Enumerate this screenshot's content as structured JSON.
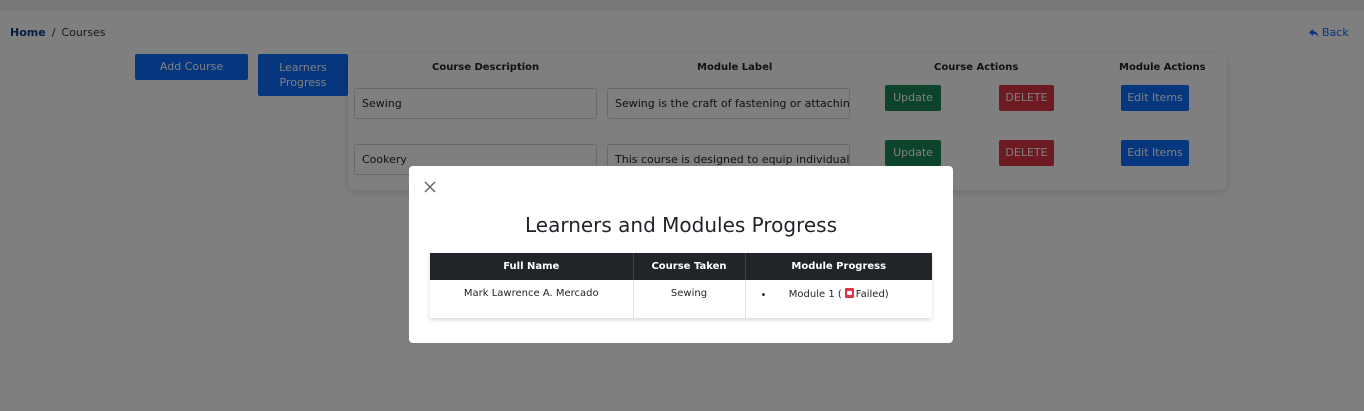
{
  "breadcrumb": {
    "home": "Home",
    "separator": "/",
    "current": "Courses"
  },
  "back": {
    "label": "Back",
    "icon": "reply-arrow-icon"
  },
  "toolbar": {
    "add_course": "Add Course",
    "learners_progress": "Learners Progress"
  },
  "courses_table": {
    "headers": {
      "description": "Course Description",
      "module_label": "Module Label",
      "course_actions": "Course Actions",
      "module_actions": "Module Actions"
    },
    "rows": [
      {
        "description": "Sewing",
        "module_label": "Sewing is the craft of fastening or attaching",
        "update": "Update",
        "delete": "DELETE",
        "edit_items": "Edit Items"
      },
      {
        "description": "Cookery",
        "module_label": "This course is designed to equip individuals",
        "update": "Update",
        "delete": "DELETE",
        "edit_items": "Edit Items"
      }
    ]
  },
  "modal": {
    "title": "Learners and Modules Progress",
    "close_icon": "close-icon",
    "table": {
      "headers": {
        "full_name": "Full Name",
        "course_taken": "Course Taken",
        "module_progress": "Module Progress"
      },
      "rows": [
        {
          "full_name": "Mark Lawrence A. Mercado",
          "course_taken": "Sewing",
          "bullet": "•",
          "module": "Module 1",
          "status_prefix": "(",
          "status": "Failed)",
          "status_icon": "pdf-file-icon"
        }
      ]
    }
  },
  "colors": {
    "primary": "#0d6efd",
    "success": "#198754",
    "danger": "#dc3545",
    "dark": "#212529"
  }
}
